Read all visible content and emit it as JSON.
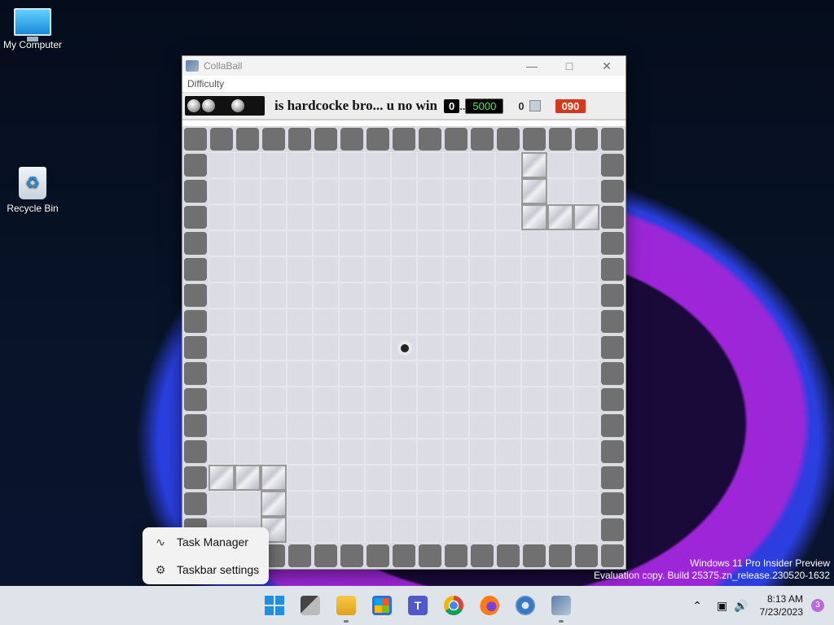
{
  "desktop": {
    "icons": [
      {
        "label": "My Computer"
      },
      {
        "label": "Recycle Bin"
      }
    ]
  },
  "window": {
    "title": "CollaBall",
    "menu": [
      "Difficulty"
    ],
    "status": {
      "message": "is hardcocke bro... u no win",
      "score_a": "0",
      "dots": "..",
      "score_b": "5000",
      "count": "0",
      "timer": "090"
    }
  },
  "context_menu": {
    "items": [
      {
        "label": "Task Manager",
        "icon": "task-manager-icon"
      },
      {
        "label": "Taskbar settings",
        "icon": "gear-icon"
      }
    ]
  },
  "watermark": {
    "line1": "Windows 11 Pro Insider Preview",
    "line2": "Evaluation copy. Build 25375.zn_release.230520-1632"
  },
  "taskbar": {
    "apps": [
      "start-icon",
      "task-view-icon",
      "file-explorer-icon",
      "store-icon",
      "teams-icon",
      "chrome-icon",
      "firefox-icon",
      "settings-icon",
      "collaball-icon"
    ],
    "time": "8:13 AM",
    "date": "7/23/2023",
    "notifications": "3"
  }
}
